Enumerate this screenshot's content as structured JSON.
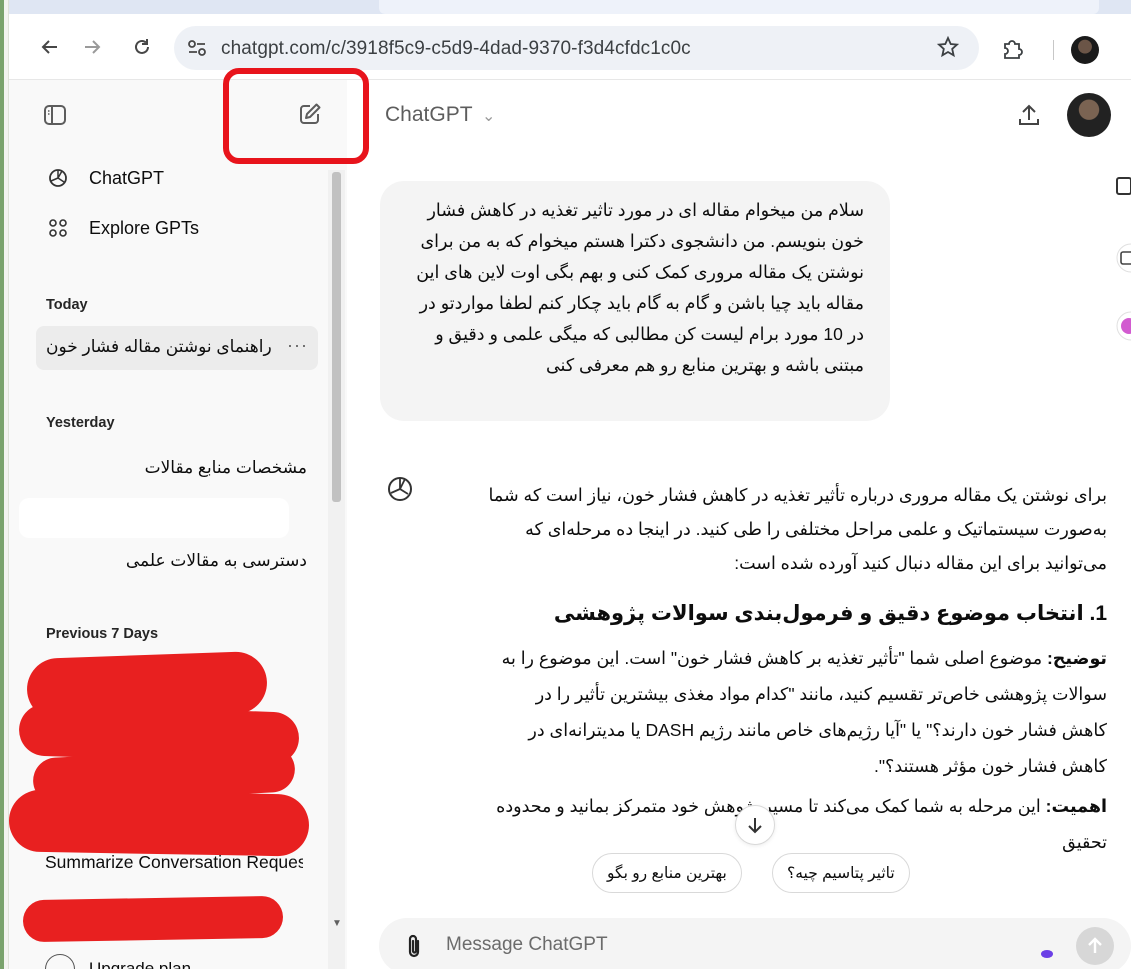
{
  "browser": {
    "url": "chatgpt.com/c/3918f5c9-c5d9-4dad-9370-f3d4cfdc1c0c",
    "icons": [
      "back-arrow-icon",
      "forward-arrow-icon",
      "reload-icon",
      "site-settings-icon",
      "bookmark-star-icon",
      "extensions-icon",
      "profile-avatar",
      "more-vert-icon"
    ]
  },
  "sidebar": {
    "top_items": [
      {
        "label": "ChatGPT",
        "icon": "chatgpt-logo-icon"
      },
      {
        "label": "Explore GPTs",
        "icon": "grid-icon"
      }
    ],
    "sections": {
      "today": "Today",
      "yesterday": "Yesterday",
      "previous": "Previous 7 Days"
    },
    "today_chats": [
      "راهنمای نوشتن مقاله فشار خون"
    ],
    "yesterday_chats": [
      "مشخصات منابع مقالات",
      "دسترسی به مقالات علمی"
    ],
    "previous_chats": [
      "Summarize Conversation Request"
    ],
    "upgrade_label": "Upgrade plan"
  },
  "header": {
    "model": "ChatGPT",
    "model_chevron": "⌄"
  },
  "conversation": {
    "user_message": "سلام من میخوام مقاله ای در مورد تاثیر تغذیه در کاهش فشار خون بنویسم. من دانشجوی دکترا هستم میخوام که به من برای نوشتن یک مقاله مروری کمک کنی و بهم بگی اوت لاین های این مقاله باید چیا باشن و گام به گام باید چکار کنم لطفا مواردتو در در 10 مورد برام لیست کن مطالبی که میگی علمی و دقیق و مبتنی باشه و بهترین منابع رو هم معرفی کنی",
    "assistant_intro": "برای نوشتن یک مقاله مروری درباره تأثیر تغذیه در کاهش فشار خون، نیاز است که شما به‌صورت سیستماتیک و علمی مراحل مختلفی را طی کنید. در اینجا ده مرحله‌ای که می‌توانید برای این مقاله دنبال کنید آورده شده است:",
    "heading_1": "1. انتخاب موضوع دقیق و فرمول‌بندی سوالات پژوهشی",
    "desc_label": "توضیح:",
    "desc_text": " موضوع اصلی شما \"تأثیر تغذیه بر کاهش فشار خون\" است. این موضوع را به سوالات پژوهشی خاص‌تر تقسیم کنید، مانند \"کدام مواد مغذی بیشترین تأثیر را در کاهش فشار خون دارند؟\" یا \"آیا رژیم‌های خاص مانند رژیم DASH یا مدیترانه‌ای در کاهش فشار خون مؤثر هستند؟\".",
    "importance_label": "اهمیت:",
    "importance_text": " این مرحله به شما کمک می‌کند تا مسیر پژوهش خود متمرکز بمانید و محدوده تحقیق"
  },
  "suggestions": [
    "تاثیر پتاسیم چیه؟",
    "بهترین منابع رو بگو"
  ],
  "composer": {
    "placeholder": "Message ChatGPT"
  },
  "colors": {
    "highlight_box": "#e8141c",
    "redaction": "#e82020",
    "sidebar_bg": "#f9f9f9",
    "bubble_bg": "#f4f4f4"
  }
}
